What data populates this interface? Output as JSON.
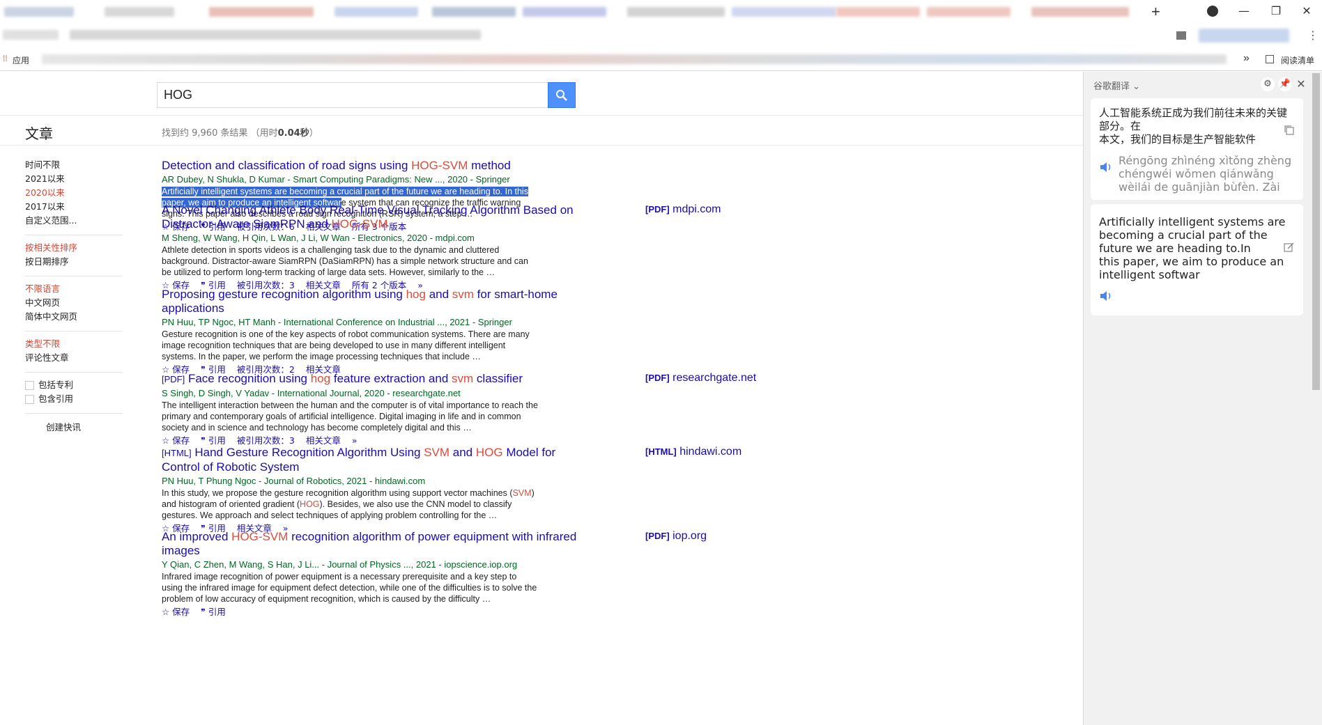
{
  "browser": {
    "bookmarks_apps_label": "应用",
    "reading_list_label": "阅读清单",
    "new_tab_symbol": "+",
    "more_bookmarks_symbol": "»"
  },
  "search": {
    "query": "HOG"
  },
  "page": {
    "section_title": "文章",
    "result_stats_prefix": "找到约 9,960 条结果 （用时",
    "result_stats_time": "0.04秒",
    "result_stats_suffix": "）"
  },
  "sidebar": {
    "time_filters": [
      "时间不限",
      "2021以来",
      "2020以来",
      "2017以来",
      "自定义范围..."
    ],
    "time_active_index": 2,
    "sort_options": [
      "按相关性排序",
      "按日期排序"
    ],
    "language_options": [
      "不限语言",
      "中文网页",
      "简体中文网页"
    ],
    "type_options": [
      "类型不限",
      "评论性文章"
    ],
    "checkbox_patents": "包括专利",
    "checkbox_citations": "包含引用",
    "create_alert": "创建快讯"
  },
  "results": [
    {
      "title_parts": [
        "Detection and classification of road signs using ",
        "HOG-SVM",
        " method"
      ],
      "authors": "AR Dubey, N Shukla, D Kumar - Smart Computing Paradigms: New ..., 2020 - Springer",
      "snippet_selected": "Artificially intelligent systems are becoming a crucial part of the future we are heading to. In this paper, we aim to produce an intelligent softwar",
      "snippet_rest": "e system that can recognize the traffic warning signs. This paper also describes a road sign recognition (RSR) system, a step …",
      "links": [
        "☆ 保存",
        "❞ 引用",
        "被引用次数：6",
        "相关文章",
        "所有 3 个版本"
      ]
    },
    {
      "title_parts": [
        "A Novel Changing Athlete Body Real-Time Visual Tracking Algorithm Based on Distractor-Aware SiamRPN and ",
        "HOG-SVM",
        ""
      ],
      "authors": "M Sheng, W Wang, H Qin, L Wan, J Li, W Wan - Electronics, 2020 - mdpi.com",
      "snippet": "Athlete detection in sports videos is a challenging task due to the dynamic and cluttered background. Distractor-aware SiamRPN (DaSiamRPN) has a simple network structure and can be utilized to perform long-term tracking of large data sets. However, similarly to the …",
      "links": [
        "☆ 保存",
        "❞ 引用",
        "被引用次数：3",
        "相关文章",
        "所有 2 个版本",
        "»"
      ],
      "side_tag": "[PDF]",
      "side_domain": "mdpi.com"
    },
    {
      "title_parts": [
        "Proposing gesture recognition algorithm using ",
        "hog",
        " and ",
        "svm",
        " for smart-home applications"
      ],
      "authors": "PN Huu, TP Ngoc, HT Manh - International Conference on Industrial ..., 2021 - Springer",
      "snippet": "Gesture recognition is one of the key aspects of robot communication systems. There are many image recognition techniques that are being developed to use in many different intelligent systems. In the paper, we perform the image processing techniques that include …",
      "links": [
        "☆ 保存",
        "❞ 引用",
        "被引用次数：2",
        "相关文章"
      ]
    },
    {
      "tag": "[PDF]",
      "title_parts": [
        "Face recognition using ",
        "hog",
        " feature extraction and ",
        "svm",
        " classifier"
      ],
      "authors": "S Singh, D Singh, V Yadav - International Journal, 2020 - researchgate.net",
      "snippet": "The intelligent interaction between the human and the computer is of vital importance to reach the primary and contemporary goals of artificial intelligence. Digital imaging in life and in common society and in science and technology has become completely digital and this …",
      "links": [
        "☆ 保存",
        "❞ 引用",
        "被引用次数：3",
        "相关文章",
        "»"
      ],
      "side_tag": "[PDF]",
      "side_domain": "researchgate.net"
    },
    {
      "tag": "[HTML]",
      "title_parts": [
        "Hand Gesture Recognition Algorithm Using ",
        "SVM",
        " and ",
        "HOG",
        " Model for Control of Robotic System"
      ],
      "authors": "PN Huu, T Phung Ngoc - Journal of Robotics, 2021 - hindawi.com",
      "snippet_parts": [
        "In this study, we propose the gesture recognition algorithm using support vector machines (",
        "SVM",
        ") and histogram of oriented gradient (",
        "HOG",
        "). Besides, we also use the CNN model to classify gestures. We approach and select techniques of applying problem controlling for the …"
      ],
      "links": [
        "☆ 保存",
        "❞ 引用",
        "相关文章",
        "»"
      ],
      "side_tag": "[HTML]",
      "side_domain": "hindawi.com"
    },
    {
      "title_parts": [
        "An improved ",
        "HOG-SVM",
        " recognition algorithm of power equipment with infrared images"
      ],
      "authors": "Y Qian, C Zhen, M Wang, S Han, J Li... - Journal of Physics ..., 2021 - iopscience.iop.org",
      "snippet": "Infrared image recognition of power equipment is a necessary prerequisite and a key step to using the infrared image for equipment defect detection, while one of the difficulties is to solve the problem of low accuracy of equipment recognition, which is caused by the difficulty …",
      "links": [
        "☆ 保存",
        "❞ 引用"
      ],
      "side_tag": "[PDF]",
      "side_domain": "iop.org"
    }
  ],
  "translate_panel": {
    "title": "谷歌翻译",
    "settings_icon": "gear-icon",
    "pin_icon": "pin-icon",
    "close_icon": "close-icon",
    "chinese_text": "人工智能系统正成为我们前往未来的关键部分。在\n本文，我们的目标是生产智能软件",
    "pinyin_text": "Réngōng zhìnéng xìtǒng zhèng chéngwéi wǒmen qiánwǎng wèilái de guānjiàn bùfèn. Zài",
    "english_text": "Artificially intelligent systems are becoming a crucial part of the future we are heading to.In\nthis paper, we aim to produce an intelligent softwar"
  },
  "colors": {
    "link": "#1a0dab",
    "highlight": "#dd4b39",
    "authors": "#006621",
    "search_button": "#4d90fe",
    "selection": "#3367d6"
  }
}
